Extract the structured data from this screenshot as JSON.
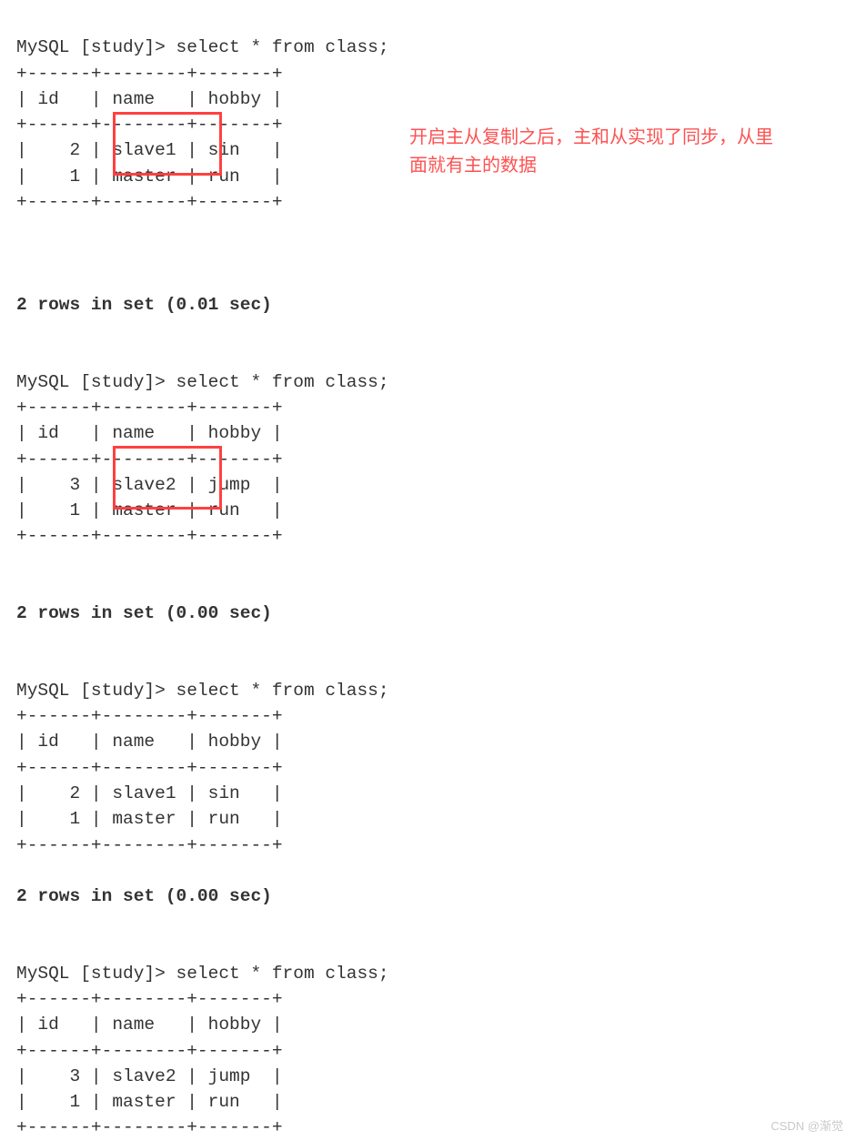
{
  "cmd1": "MySQL [study]> select * from class;",
  "sep": "+------+--------+-------+",
  "hdr": "| id   | name   | hobby |",
  "q1r1": "|    2 | slave1 | sin   |",
  "q1r2": "|    1 | master | run   |",
  "res1": "2 rows in set (0.01 sec)",
  "cmd2": "MySQL [study]> select * from class;",
  "q2r1": "|    3 | slave2 | jump  |",
  "q2r2": "|    1 | master | run   |",
  "res2": "2 rows in set (0.00 sec)",
  "cmd3": "MySQL [study]> select * from class;",
  "q3r1": "|    2 | slave1 | sin   |",
  "q3r2": "|    1 | master | run   |",
  "res3": "2 rows in set (0.00 sec)",
  "cmd4": "MySQL [study]> select * from class;",
  "q4r1": "|    3 | slave2 | jump  |",
  "q4r2": "|    1 | master | run   |",
  "annotation": "开启主从复制之后，主和从实现了同步，从里面就有主的数据",
  "watermark": "CSDN @渐觉"
}
